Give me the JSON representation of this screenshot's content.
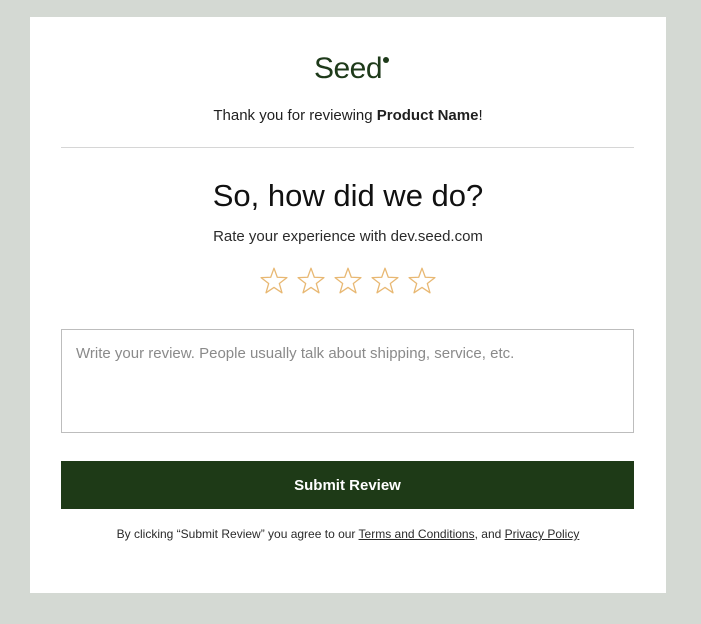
{
  "brand": {
    "logo_text": "Seed"
  },
  "thanks": {
    "prefix": "Thank you for reviewing ",
    "product_name": "Product Name",
    "suffix": "!"
  },
  "rating": {
    "headline": "So, how did we do?",
    "subtitle": "Rate your experience with dev.seed.com",
    "max_stars": 5,
    "selected_stars": 0,
    "star_color": "#e8b873"
  },
  "review": {
    "value": "",
    "placeholder": "Write your review. People usually talk about shipping, service, etc."
  },
  "submit": {
    "label": "Submit Review",
    "bg_color": "#1e3a17"
  },
  "legal": {
    "prefix": "By clicking “Submit Review” you agree to our ",
    "terms_label": "Terms and Conditions",
    "middle": ", and ",
    "privacy_label": "Privacy Policy"
  },
  "colors": {
    "page_background": "#d4d9d3",
    "card_background": "#ffffff",
    "brand_green": "#1e3a1a"
  }
}
